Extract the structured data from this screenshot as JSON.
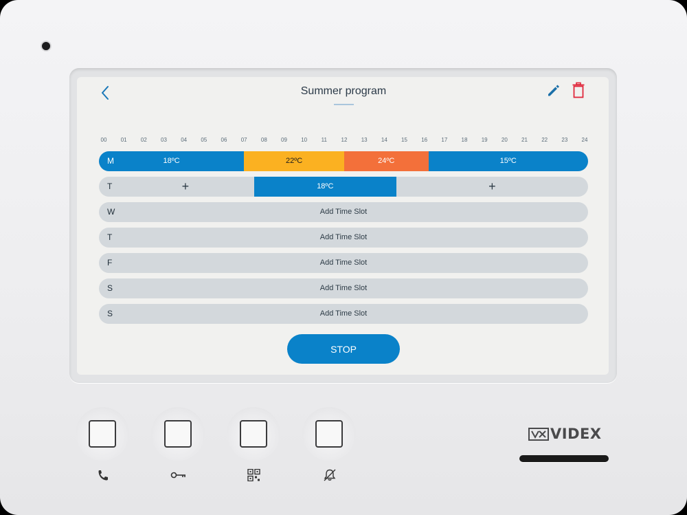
{
  "header": {
    "title": "Summer program"
  },
  "hours": [
    "00",
    "01",
    "02",
    "03",
    "04",
    "05",
    "06",
    "07",
    "08",
    "09",
    "10",
    "11",
    "12",
    "13",
    "14",
    "15",
    "16",
    "17",
    "18",
    "19",
    "20",
    "21",
    "22",
    "23",
    "24"
  ],
  "days": [
    {
      "letter": "M",
      "segments": [
        {
          "from": 0,
          "to": 7,
          "label": "18ºC",
          "color": "#0a82c9"
        },
        {
          "from": 7,
          "to": 12,
          "label": "22ºC",
          "color": "#fbb121"
        },
        {
          "from": 12,
          "to": 16.2,
          "label": "24ºC",
          "color": "#f3703a"
        },
        {
          "from": 16.2,
          "to": 24,
          "label": "15ºC",
          "color": "#0a82c9"
        }
      ]
    },
    {
      "letter": "T",
      "segments": [
        {
          "from": 7.5,
          "to": 14.6,
          "label": "18ºC",
          "color": "#0a82c9"
        }
      ],
      "add_before": "+",
      "add_after": "+"
    },
    {
      "letter": "W",
      "empty_text": "Add Time Slot"
    },
    {
      "letter": "T",
      "empty_text": "Add Time Slot"
    },
    {
      "letter": "F",
      "empty_text": "Add Time Slot"
    },
    {
      "letter": "S",
      "empty_text": "Add Time Slot"
    },
    {
      "letter": "S",
      "empty_text": "Add Time Slot"
    }
  ],
  "stop_label": "STOP",
  "brand": {
    "name": "VIDEX"
  },
  "icons": {
    "back": "chevron-left-icon",
    "edit": "pencil-icon",
    "delete": "trash-icon",
    "hw1": "phone-icon",
    "hw2": "key-icon",
    "hw3": "qr-grid-icon",
    "hw4": "bell-off-icon"
  },
  "colors": {
    "primary": "#0a82c9",
    "warm": "#fbb121",
    "hot": "#f3703a",
    "delete": "#e0273b"
  }
}
